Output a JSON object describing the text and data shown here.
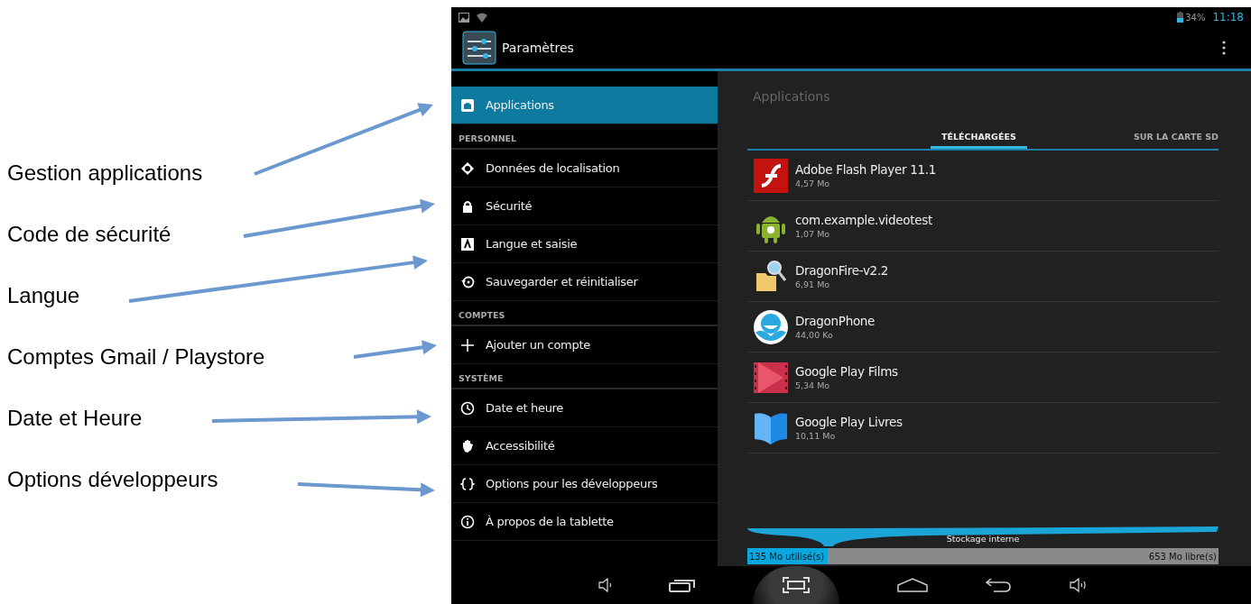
{
  "annotations": [
    {
      "label": "Gestion applications"
    },
    {
      "label": "Code de sécurité"
    },
    {
      "label": "Langue"
    },
    {
      "label": "Comptes Gmail / Playstore"
    },
    {
      "label": "Date et Heure"
    },
    {
      "label": "Options développeurs"
    }
  ],
  "status_bar": {
    "battery": "34%",
    "time": "11:18"
  },
  "action_bar": {
    "title": "Paramètres"
  },
  "sidebar": {
    "items": [
      {
        "kind": "item",
        "label": "Applications",
        "selected": true
      },
      {
        "kind": "header",
        "label": "PERSONNEL"
      },
      {
        "kind": "item",
        "label": "Données de localisation",
        "selected": false
      },
      {
        "kind": "item",
        "label": "Sécurité",
        "selected": false
      },
      {
        "kind": "item",
        "label": "Langue et saisie",
        "selected": false
      },
      {
        "kind": "item",
        "label": "Sauvegarder et réinitialiser",
        "selected": false
      },
      {
        "kind": "header",
        "label": "COMPTES"
      },
      {
        "kind": "item",
        "label": "Ajouter un compte",
        "selected": false
      },
      {
        "kind": "header",
        "label": "SYSTÈME"
      },
      {
        "kind": "item",
        "label": "Date et heure",
        "selected": false
      },
      {
        "kind": "item",
        "label": "Accessibilité",
        "selected": false
      },
      {
        "kind": "item",
        "label": "Options pour les développeurs",
        "selected": false
      },
      {
        "kind": "item",
        "label": "À propos de la tablette",
        "selected": false
      }
    ]
  },
  "panel": {
    "title": "Applications",
    "tabs": [
      {
        "label": "TÉLÉCHARGÉES",
        "selected": true
      },
      {
        "label": "SUR LA CARTE SD",
        "selected": false
      }
    ],
    "apps": [
      {
        "name": "Adobe Flash Player 11.1",
        "size": "4,57 Mo"
      },
      {
        "name": "com.example.videotest",
        "size": "1,07 Mo"
      },
      {
        "name": "DragonFire-v2.2",
        "size": "6,91 Mo"
      },
      {
        "name": "DragonPhone",
        "size": "44,00 Ko"
      },
      {
        "name": "Google Play Films",
        "size": "5,34 Mo"
      },
      {
        "name": "Google Play Livres",
        "size": "10,11 Mo"
      }
    ],
    "storage": {
      "label": "Stockage interne",
      "used": "135 Mo utilisé(s)",
      "free": "653 Mo libre(s)",
      "level": 0.17
    }
  }
}
